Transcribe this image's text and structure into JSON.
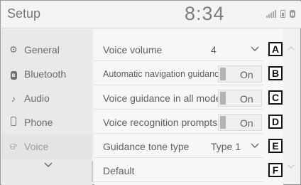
{
  "header": {
    "title": "Setup",
    "clock": "8:34"
  },
  "status_icons": [
    "signal-icon",
    "battery-icon",
    "bluetooth-icon"
  ],
  "sidebar": {
    "items": [
      {
        "label": "General",
        "icon": "gear-icon",
        "active": false
      },
      {
        "label": "Bluetooth",
        "icon": "bluetooth-icon",
        "active": false
      },
      {
        "label": "Audio",
        "icon": "music-note-icon",
        "active": false
      },
      {
        "label": "Phone",
        "icon": "phone-icon",
        "active": false
      },
      {
        "label": "Voice",
        "icon": "voice-icon",
        "active": true
      }
    ],
    "more_icon": "chevron-down-icon"
  },
  "settings": {
    "rows": [
      {
        "label": "Voice volume",
        "value": "4",
        "control": "dropdown",
        "callout": "A"
      },
      {
        "label": "Automatic navigation guidance",
        "value": "On",
        "control": "toggle",
        "callout": "B"
      },
      {
        "label": "Voice guidance in all modes",
        "value": "On",
        "control": "toggle",
        "callout": "C"
      },
      {
        "label": "Voice recognition prompts",
        "value": "On",
        "control": "toggle",
        "callout": "D"
      },
      {
        "label": "Guidance tone type",
        "value": "Type 1",
        "control": "dropdown",
        "callout": "E"
      },
      {
        "label": "Default",
        "value": "",
        "control": "button",
        "callout": "F"
      }
    ]
  },
  "colors": {
    "background": "#f1f1f1",
    "text": "#5e5e5e",
    "callout_border": "#111111"
  }
}
